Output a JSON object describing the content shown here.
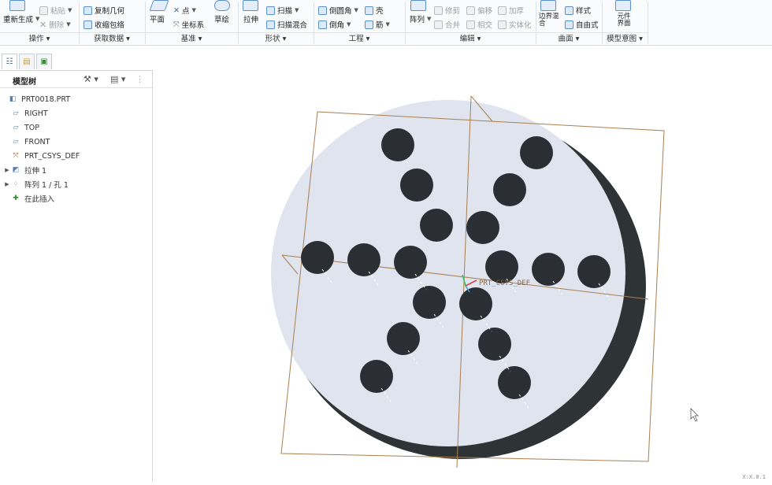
{
  "ribbon": {
    "operations": {
      "regenerate": "重新生成",
      "paste": "粘贴",
      "delete": "删除",
      "group": "操作"
    },
    "get_data": {
      "copy_geometry": "复制几何",
      "shrinkwrap": "收缩包络",
      "group": "获取数据"
    },
    "datum": {
      "plane": "平面",
      "point": "点",
      "csys": "坐标系",
      "sketch": "草绘",
      "group": "基准"
    },
    "shapes": {
      "extrude": "拉伸",
      "sweep": "扫描",
      "swept_blend": "扫描混合",
      "group": "形状"
    },
    "engineering": {
      "round": "倒圆角",
      "chamfer": "倒角",
      "shell": "壳",
      "rib": "筋",
      "group": "工程"
    },
    "editing": {
      "pattern": "阵列",
      "trim": "修剪",
      "offset": "偏移",
      "thicken": "加厚",
      "merge": "合并",
      "intersect": "相交",
      "solidify": "实体化",
      "group": "编辑"
    },
    "surfaces": {
      "boundary_blend": "边界混合",
      "style": "样式",
      "freestyle": "自由式",
      "group": "曲面"
    },
    "model_intent": {
      "component_interface": "元件界面",
      "group": "模型意图"
    }
  },
  "model_tree": {
    "title": "模型树",
    "items": [
      {
        "label": "PRT0018.PRT",
        "icon": "part-icon",
        "expand": ""
      },
      {
        "label": "RIGHT",
        "icon": "datum-plane-icon",
        "expand": ""
      },
      {
        "label": "TOP",
        "icon": "datum-plane-icon",
        "expand": ""
      },
      {
        "label": "FRONT",
        "icon": "datum-plane-icon",
        "expand": ""
      },
      {
        "label": "PRT_CSYS_DEF",
        "icon": "csys-icon",
        "expand": ""
      },
      {
        "label": "拉伸 1",
        "icon": "extrude-icon",
        "expand": "▶"
      },
      {
        "label": "阵列 1 / 孔 1",
        "icon": "pattern-icon",
        "expand": "▶"
      },
      {
        "label": "在此插入",
        "icon": "insert-here-icon",
        "expand": ""
      }
    ]
  },
  "viewport": {
    "csys_label": "PRT_CSYS_DEF",
    "status": "X:X.0.1"
  },
  "colors": {
    "face": "#dfe4ee",
    "side": "#2e3336",
    "hole": "#2b2f33",
    "datum": "#a87f50",
    "accent": "#5a8fc7"
  }
}
